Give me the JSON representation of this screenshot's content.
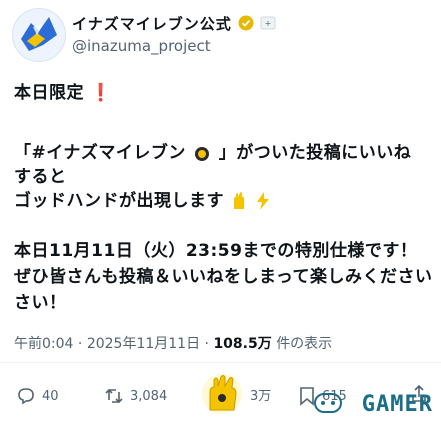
{
  "header": {
    "display_name": "イナズマイレブン公式",
    "handle": "@inazuma_project",
    "verified_icon": "verified-badge-icon",
    "extra_icon": "subscribe-icon"
  },
  "tweet": {
    "line1": "本日限定",
    "line1_mark": "❗",
    "line2": "「#イナズマイレブン",
    "line2_b": "」がついた投稿にいいね",
    "line3": "すると",
    "line4": "ゴッドハンドが出現します",
    "line5": "本日11月11日（火）23:59までの特別仕様です！",
    "line6": "ぜひ皆さんも投稿＆いいねをしまって楽しみください",
    "line7": "さい！"
  },
  "meta": {
    "time": "午前0:04",
    "date": "2025年11月11日",
    "views": "108.5万",
    "views_label": "件の表示"
  },
  "actions": {
    "replies": "40",
    "reposts": "3,084",
    "likes": "3万",
    "bookmarks": "615"
  },
  "watermark": {
    "text": "GAMER"
  },
  "colors": {
    "accent_red": "#e0245e",
    "muted": "#536471",
    "gold": "#f5c400",
    "watermark": "#1b6e89"
  }
}
